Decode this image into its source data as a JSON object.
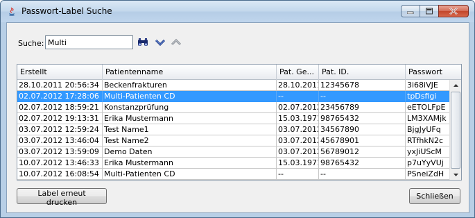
{
  "window": {
    "title": "Passwort-Label Suche"
  },
  "search": {
    "label": "Suche:",
    "value": "Multi",
    "placeholder": ""
  },
  "table": {
    "columns": [
      "Erstellt",
      "Patientenname",
      "Pat. Ge...",
      "Pat. ID.",
      "Passwort"
    ],
    "rows": [
      [
        "28.10.2011 20:56:34",
        "Beckenfrakturen",
        "28.10.2011",
        "12345678",
        "3i68iVJE"
      ],
      [
        "02.07.2012 17:28:06",
        "Multi-Patienten CD",
        "--",
        "--",
        "tpDsfigi"
      ],
      [
        "02.07.2012 18:59:21",
        "Konstanzprüfung",
        "02.07.2012",
        "23456789",
        "eETOLFpE"
      ],
      [
        "02.07.2012 19:13:31",
        "Erika Mustermann",
        "15.03.1971",
        "98765432",
        "LM3XAMjk"
      ],
      [
        "03.07.2012 12:59:24",
        "Test Name1",
        "03.07.2012",
        "34567890",
        "BjgJyUFq"
      ],
      [
        "03.07.2012 13:46:04",
        "Test Name2",
        "03.07.2012",
        "45678901",
        "RTfhkN2c"
      ],
      [
        "03.07.2012 13:59:09",
        "Demo Daten",
        "03.07.2012",
        "56789012",
        "yxJiUScM"
      ],
      [
        "10.07.2012 13:46:33",
        "Erika Mustermann",
        "15.03.1971",
        "98765432",
        "p7uYyVUj"
      ],
      [
        "10.07.2012 16:08:54",
        "Multi-Patienten CD",
        "--",
        "--",
        "PSneiZdH"
      ]
    ],
    "selected_row": 1
  },
  "buttons": {
    "print_label": "Label erneut drucken",
    "close_label": "Schließen"
  },
  "icons": {
    "search": "binoculars-icon",
    "next": "chevron-down-icon",
    "previous": "chevron-up-icon"
  },
  "colors": {
    "selection": "#3399ff",
    "accent": "#1f3c88"
  }
}
